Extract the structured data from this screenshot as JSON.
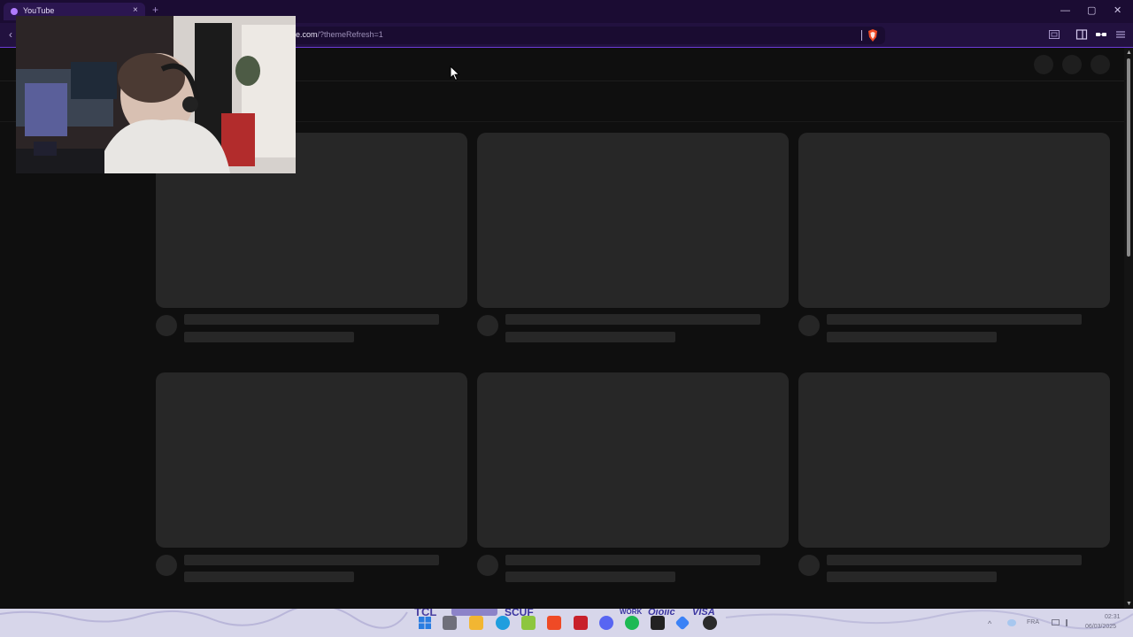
{
  "browser": {
    "tab_title": "YouTube",
    "tab_close": "×",
    "new_tab": "+",
    "back": "‹",
    "url_host": "e.com",
    "url_rest": "/?themeRefresh=1",
    "minimize": "—",
    "maximize": "▢",
    "close": "✕",
    "accent_color": "#6d3bd6"
  },
  "icons": {
    "brave": "brave-shield-icon",
    "sidebar": "sidebar-icon",
    "wallet": "wallet-icon",
    "menu": "menu-icon"
  },
  "page": {
    "state": "loading skeleton",
    "cards": 6
  },
  "taskbar": {
    "language": "FRA",
    "time": "02:31",
    "date": "06/03/2025"
  }
}
